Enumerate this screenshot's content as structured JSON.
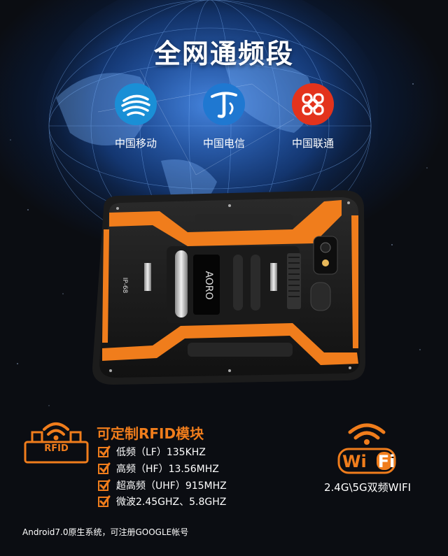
{
  "headline": "全网通频段",
  "carriers": [
    {
      "name": "中国移动",
      "color": "#1a8fd6"
    },
    {
      "name": "中国电信",
      "color": "#1f78d1"
    },
    {
      "name": "中国联通",
      "color": "#e3331c"
    }
  ],
  "device": {
    "brand": "AORO",
    "rating": "IP-68"
  },
  "rfid": {
    "badge": "RFID",
    "title": "可定制RFID模块",
    "features": [
      "低频（LF）135KHZ",
      "高频（HF）13.56MHZ",
      "超高频（UHF）915MHZ",
      "微波2.45GHZ、5.8GHZ"
    ]
  },
  "wifi": {
    "logo_text": "WiFi",
    "caption": "2.4G\\5G双频WIFI"
  },
  "footer": "Android7.0原生系统，可注册GOOGLE帐号",
  "colors": {
    "accent": "#f07d1c",
    "background": "#0b0d12"
  }
}
